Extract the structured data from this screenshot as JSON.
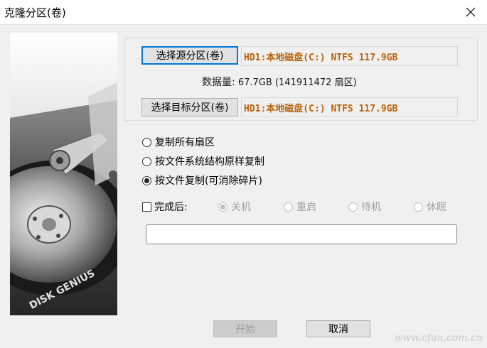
{
  "window": {
    "title": "克隆分区(卷)"
  },
  "source": {
    "button_label": "选择源分区(卷)",
    "value": "HD1:本地磁盘(C:) NTFS 117.9GB"
  },
  "data_info": {
    "label": "数据量:",
    "value": "67.7GB (141911472 扇区)"
  },
  "target": {
    "button_label": "选择目标分区(卷)",
    "value": "HD1:本地磁盘(C:) NTFS 117.9GB"
  },
  "copy_modes": [
    {
      "label": "复制所有扇区",
      "selected": false
    },
    {
      "label": "按文件系统结构原样复制",
      "selected": false
    },
    {
      "label": "按文件复制(可消除碎片)",
      "selected": true
    }
  ],
  "after_complete": {
    "label": "完成后:",
    "checked": false,
    "options": [
      {
        "label": "关机",
        "selected": true,
        "enabled": false
      },
      {
        "label": "重启",
        "selected": false,
        "enabled": false
      },
      {
        "label": "待机",
        "selected": false,
        "enabled": false
      },
      {
        "label": "休眠",
        "selected": false,
        "enabled": false
      }
    ]
  },
  "progress": {
    "value": 0
  },
  "buttons": {
    "start": "开始",
    "cancel": "取消"
  },
  "image": {
    "logo_text": "DISK GENIUS"
  },
  "watermark": "www.cfan.com.cn",
  "colors": {
    "value_text": "#b8630b",
    "focus_border": "#0078d7"
  }
}
